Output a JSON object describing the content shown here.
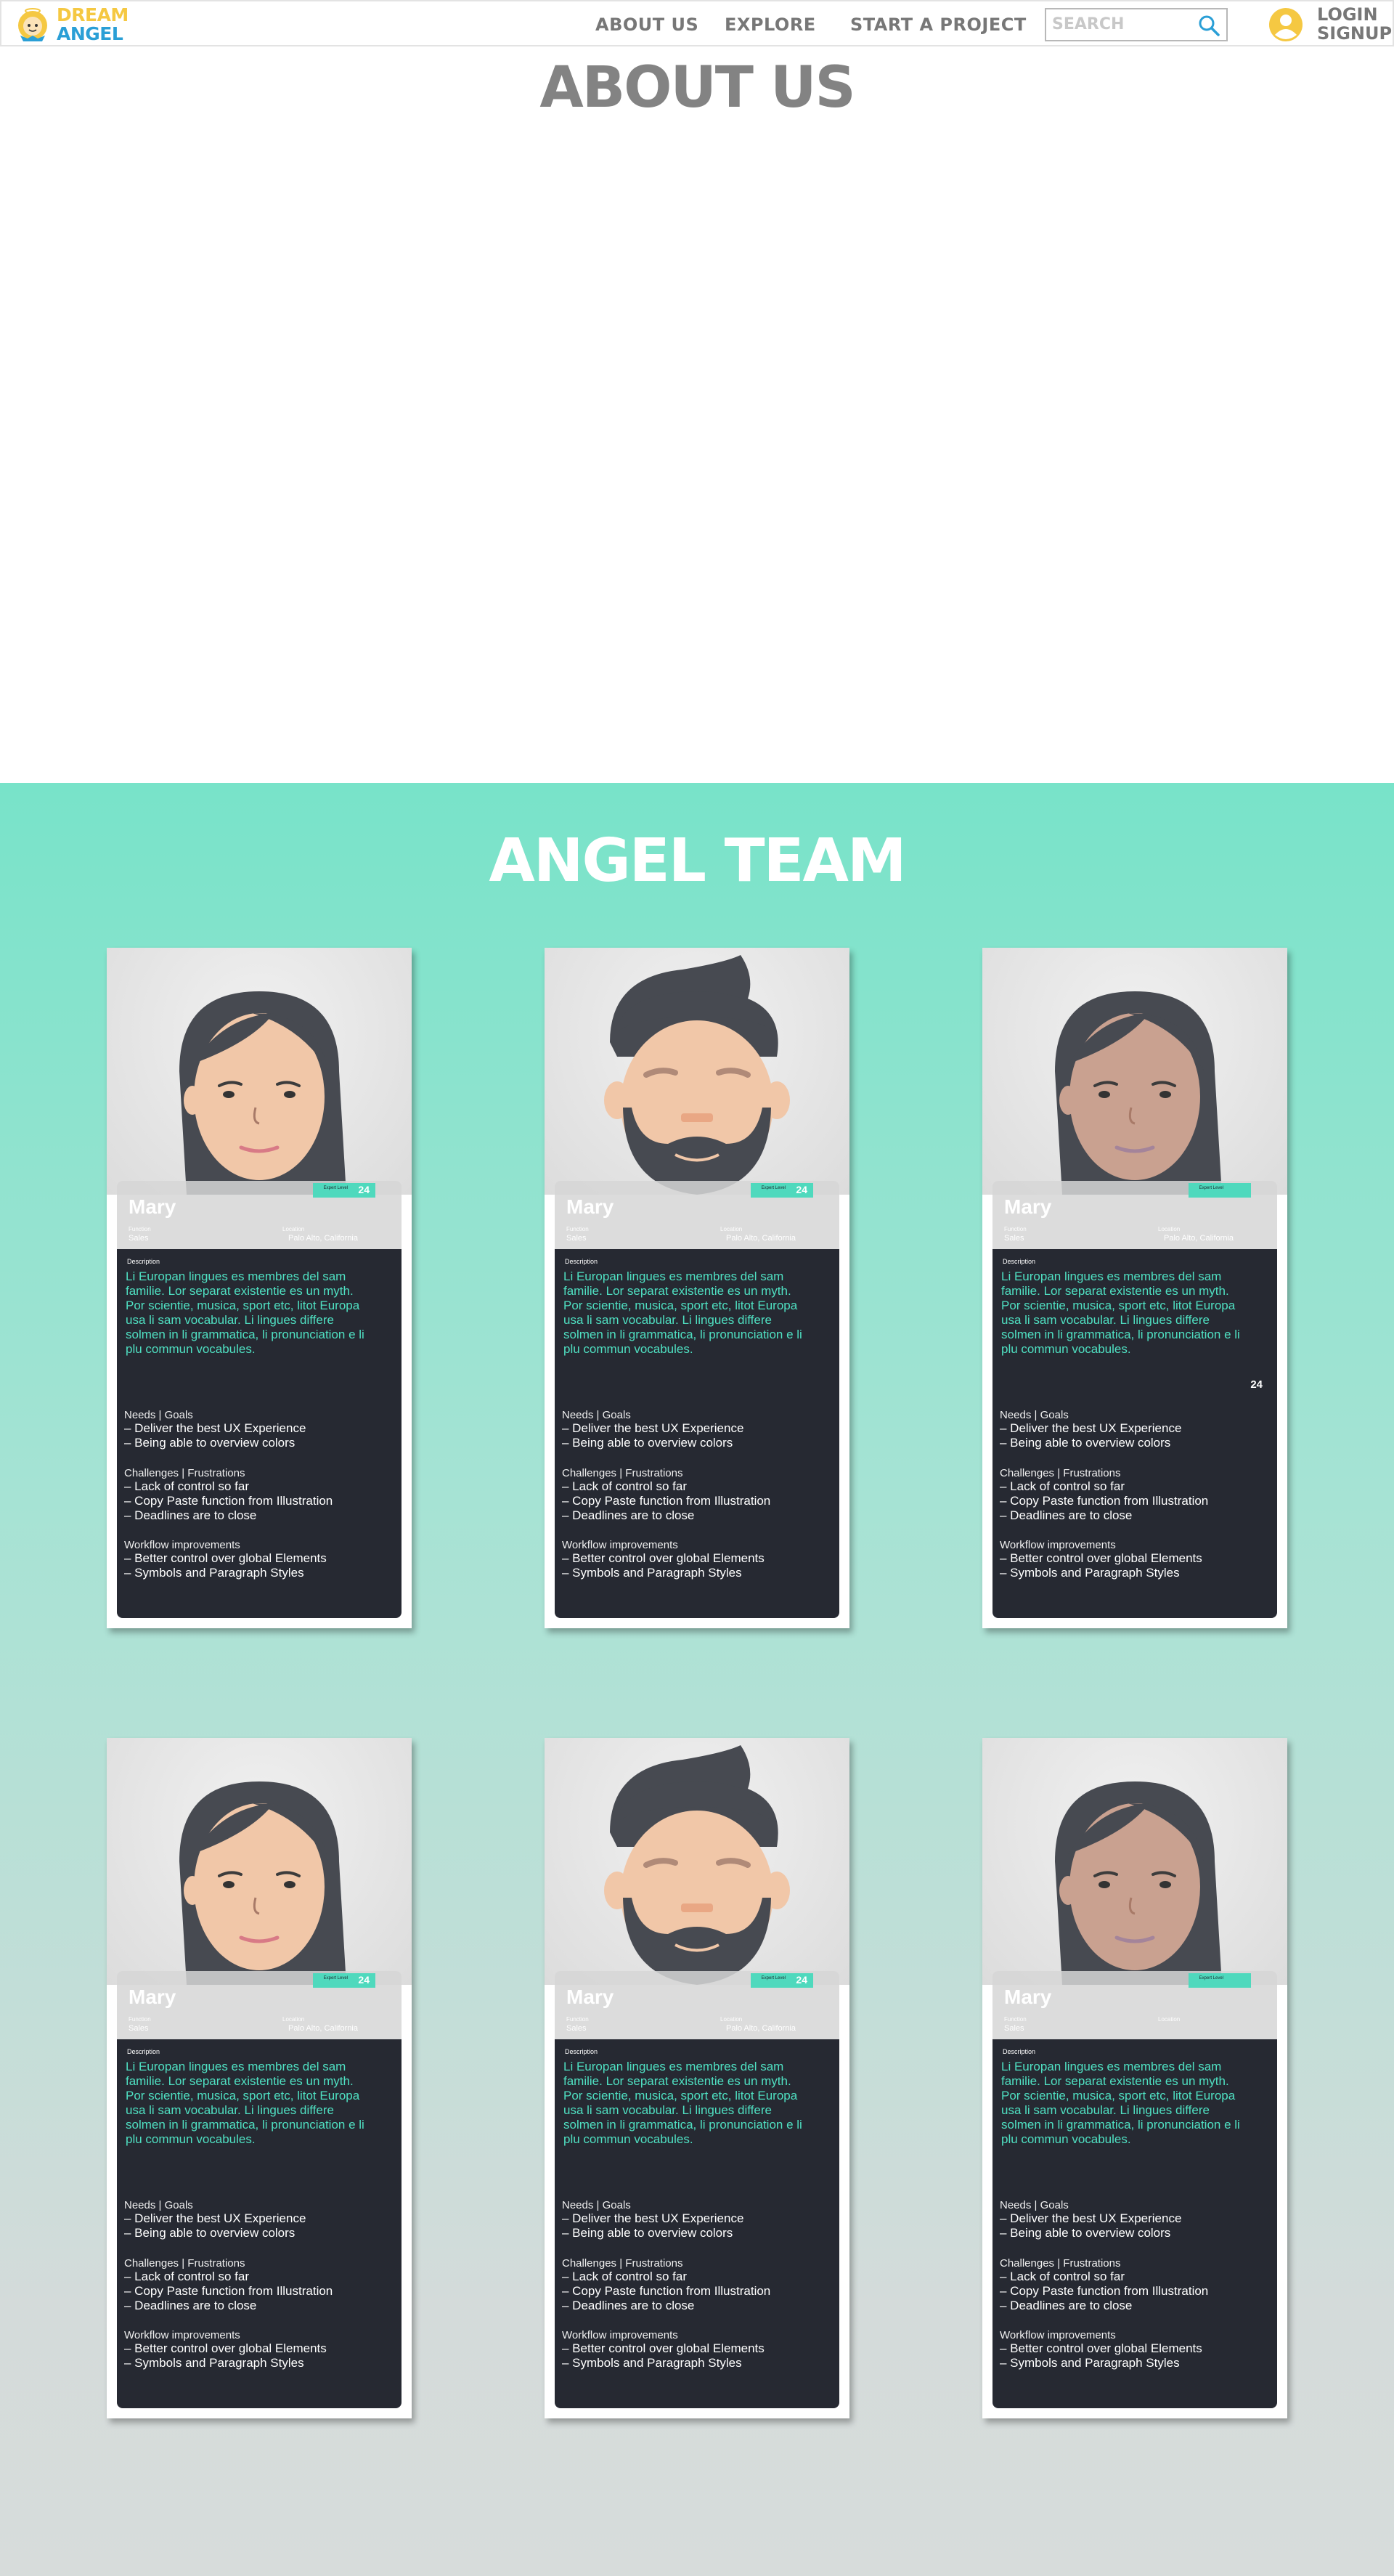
{
  "nav": {
    "logo_line1": "DREAM",
    "logo_line2": "ANGEL",
    "links": [
      "ABOUT US",
      "EXPLORE",
      "START A PROJECT"
    ],
    "search_placeholder": "SEARCH",
    "login_line1": "LOGIN",
    "login_line2": "SIGNUP"
  },
  "about": {
    "title": "ABOUT US"
  },
  "team": {
    "title": "ANGEL TEAM",
    "labels": {
      "description": "Description",
      "function": "Function",
      "location": "Location",
      "badge": "Expert Level",
      "needs": "Needs | Goals",
      "challenges": "Challenges | Frustrations",
      "workflow": "Workflow improvements"
    },
    "cards": [
      {
        "name": "Mary",
        "avatar": "woman-light",
        "function": "Sales",
        "location": "Palo Alto, California",
        "badge_num": "24",
        "description": "Li Europan lingues es membres del sam familie. Lor separat existentie es un myth. Por scientie, musica, sport etc, litot Europa usa li sam vocabular. Li lingues differe solmen in li grammatica, li pronunciation e li plu commun vocabules.",
        "needs": [
          "– Deliver the best UX Experience",
          "– Being able to overview colors"
        ],
        "challenges": [
          "– Lack of control so far",
          "– Copy Paste function from Illustration",
          "– Deadlines are to close"
        ],
        "workflow": [
          "– Better control over global Elements",
          "– Symbols and Paragraph Styles"
        ],
        "extra_num": ""
      },
      {
        "name": "Mary",
        "avatar": "man-beard",
        "function": "Sales",
        "location": "Palo Alto, California",
        "badge_num": "24",
        "description": "Li Europan lingues es membres del sam familie. Lor separat existentie es un myth. Por scientie, musica, sport etc, litot Europa usa li sam vocabular. Li lingues differe solmen in li grammatica, li pronunciation e li plu commun vocabules.",
        "needs": [
          "– Deliver the best UX Experience",
          "– Being able to overview colors"
        ],
        "challenges": [
          "– Lack of control so far",
          "– Copy Paste function from Illustration",
          "– Deadlines are to close"
        ],
        "workflow": [
          "– Better control over global Elements",
          "– Symbols and Paragraph Styles"
        ],
        "extra_num": ""
      },
      {
        "name": "Mary",
        "avatar": "woman-tan",
        "function": "Sales",
        "location": "Palo Alto, California",
        "badge_num": "",
        "description": "Li Europan lingues es membres del sam familie. Lor separat existentie es un myth. Por scientie, musica, sport etc, litot Europa usa li sam vocabular. Li lingues differe solmen in li grammatica, li pronunciation e li plu commun vocabules.",
        "needs": [
          "– Deliver the best UX Experience",
          "– Being able to overview colors"
        ],
        "challenges": [
          "– Lack of control so far",
          "– Copy Paste function from Illustration",
          "– Deadlines are to close"
        ],
        "workflow": [
          "– Better control over global Elements",
          "– Symbols and Paragraph Styles"
        ],
        "extra_num": "24"
      },
      {
        "name": "Mary",
        "avatar": "woman-light",
        "function": "Sales",
        "location": "Palo Alto, California",
        "badge_num": "24",
        "description": "Li Europan lingues es membres del sam familie. Lor separat existentie es un myth. Por scientie, musica, sport etc, litot Europa usa li sam vocabular. Li lingues differe solmen in li grammatica, li pronunciation e li plu commun vocabules.",
        "needs": [
          "– Deliver the best UX Experience",
          "– Being able to overview colors"
        ],
        "challenges": [
          "– Lack of control so far",
          "– Copy Paste function from Illustration",
          "– Deadlines are to close"
        ],
        "workflow": [
          "– Better control over global Elements",
          "– Symbols and Paragraph Styles"
        ],
        "extra_num": ""
      },
      {
        "name": "Mary",
        "avatar": "man-beard",
        "function": "Sales",
        "location": "Palo Alto, California",
        "badge_num": "24",
        "description": "Li Europan lingues es membres del sam familie. Lor separat existentie es un myth. Por scientie, musica, sport etc, litot Europa usa li sam vocabular. Li lingues differe solmen in li grammatica, li pronunciation e li plu commun vocabules.",
        "needs": [
          "– Deliver the best UX Experience",
          "– Being able to overview colors"
        ],
        "challenges": [
          "– Lack of control so far",
          "– Copy Paste function from Illustration",
          "– Deadlines are to close"
        ],
        "workflow": [
          "– Better control over global Elements",
          "– Symbols and Paragraph Styles"
        ],
        "extra_num": ""
      },
      {
        "name": "Mary",
        "avatar": "woman-tan",
        "function": "Sales",
        "location": "",
        "badge_num": "",
        "description": "Li Europan lingues es membres del sam familie. Lor separat existentie es un myth. Por scientie, musica, sport etc, litot Europa usa li sam vocabular. Li lingues differe solmen in li grammatica, li pronunciation e li plu commun vocabules.",
        "needs": [
          "– Deliver the best UX Experience",
          "– Being able to overview colors"
        ],
        "challenges": [
          "– Lack of control so far",
          "– Copy Paste function from Illustration",
          "– Deadlines are to close"
        ],
        "workflow": [
          "– Better control over global Elements",
          "– Symbols and Paragraph Styles"
        ],
        "extra_num": ""
      }
    ]
  },
  "colors": {
    "accent": "#4fe0c2",
    "panel": "#262932",
    "logo_yellow": "#f5c842",
    "logo_blue": "#2a9fd6",
    "nav_text": "#777777"
  }
}
